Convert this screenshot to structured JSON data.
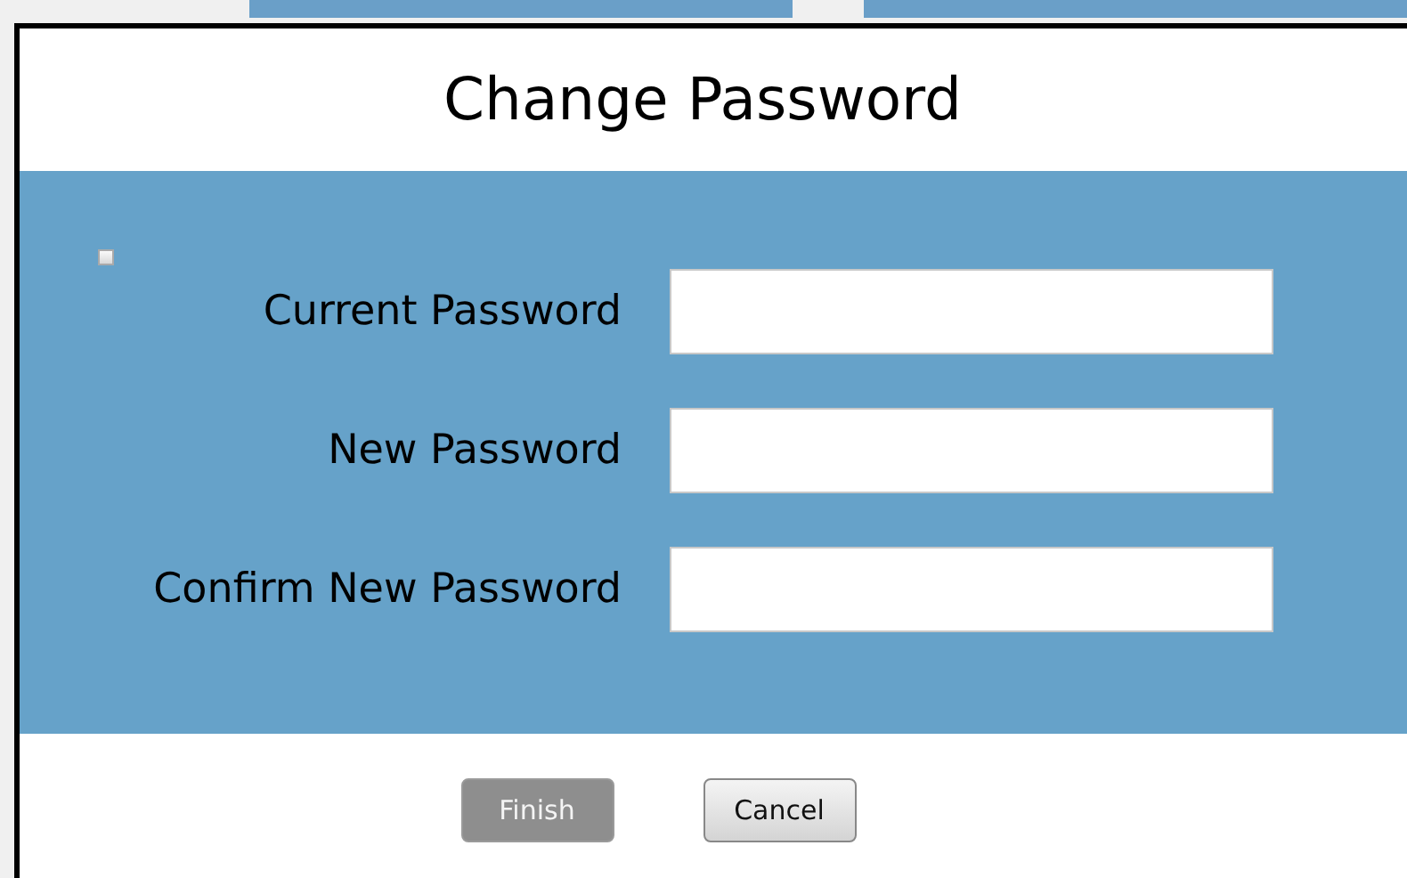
{
  "dialog": {
    "title": "Change Password"
  },
  "fields": [
    {
      "label": "Current Password"
    },
    {
      "label": "New Password"
    },
    {
      "label": "Confirm New Password"
    }
  ],
  "buttons": [
    {
      "label": "Finish",
      "disabled": true
    },
    {
      "label": "Cancel",
      "disabled": false
    }
  ]
}
